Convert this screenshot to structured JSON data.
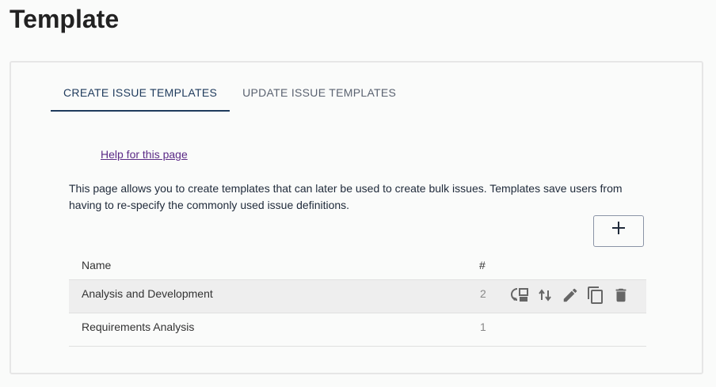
{
  "page": {
    "title": "Template"
  },
  "tabs": [
    {
      "label": "CREATE ISSUE TEMPLATES",
      "active": true
    },
    {
      "label": "UPDATE ISSUE TEMPLATES",
      "active": false
    }
  ],
  "help": {
    "link_text": "Help for this page"
  },
  "description": "This page allows you to create templates that can later be used to create bulk issues. Templates save users from having to re-specify the commonly used issue definitions.",
  "add_button": {
    "icon": "plus-icon"
  },
  "table": {
    "columns": {
      "name": "Name",
      "count": "#"
    },
    "rows": [
      {
        "name": "Analysis and Development",
        "count": "2"
      },
      {
        "name": "Requirements Analysis",
        "count": "1"
      }
    ]
  },
  "row_actions": [
    "convert-icon",
    "sort-icon",
    "edit-icon",
    "copy-icon",
    "delete-icon"
  ],
  "colors": {
    "accent": "#1e3a5c",
    "link": "#5b2a86",
    "icon": "#666666"
  }
}
